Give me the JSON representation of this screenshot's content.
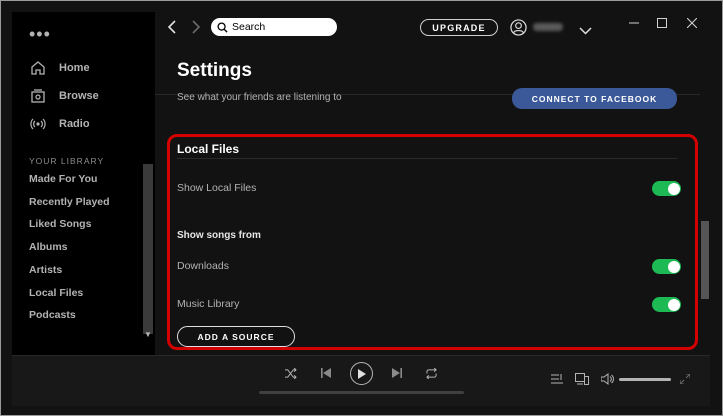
{
  "app": {
    "menu_dots": "•••"
  },
  "sidebar": {
    "nav": [
      {
        "label": "Home",
        "icon": "home-icon"
      },
      {
        "label": "Browse",
        "icon": "browse-icon"
      },
      {
        "label": "Radio",
        "icon": "radio-icon"
      }
    ],
    "library_heading": "YOUR LIBRARY",
    "library_items": [
      "Made For You",
      "Recently Played",
      "Liked Songs",
      "Albums",
      "Artists",
      "Local Files",
      "Podcasts"
    ]
  },
  "topbar": {
    "search_placeholder": "Search",
    "upgrade_label": "UPGRADE"
  },
  "settings": {
    "title": "Settings",
    "friends_text": "See what your friends are listening to",
    "facebook_button": "CONNECT TO FACEBOOK",
    "local_files": {
      "title": "Local Files",
      "show_local_files": {
        "label": "Show Local Files",
        "enabled": true
      },
      "show_songs_from": "Show songs from",
      "sources": [
        {
          "label": "Downloads",
          "enabled": true
        },
        {
          "label": "Music Library",
          "enabled": true
        }
      ],
      "add_source_button": "ADD A SOURCE"
    }
  },
  "colors": {
    "accent_green": "#1db954",
    "facebook_blue": "#3b5998",
    "highlight_red": "#d40000",
    "background": "#121212"
  }
}
